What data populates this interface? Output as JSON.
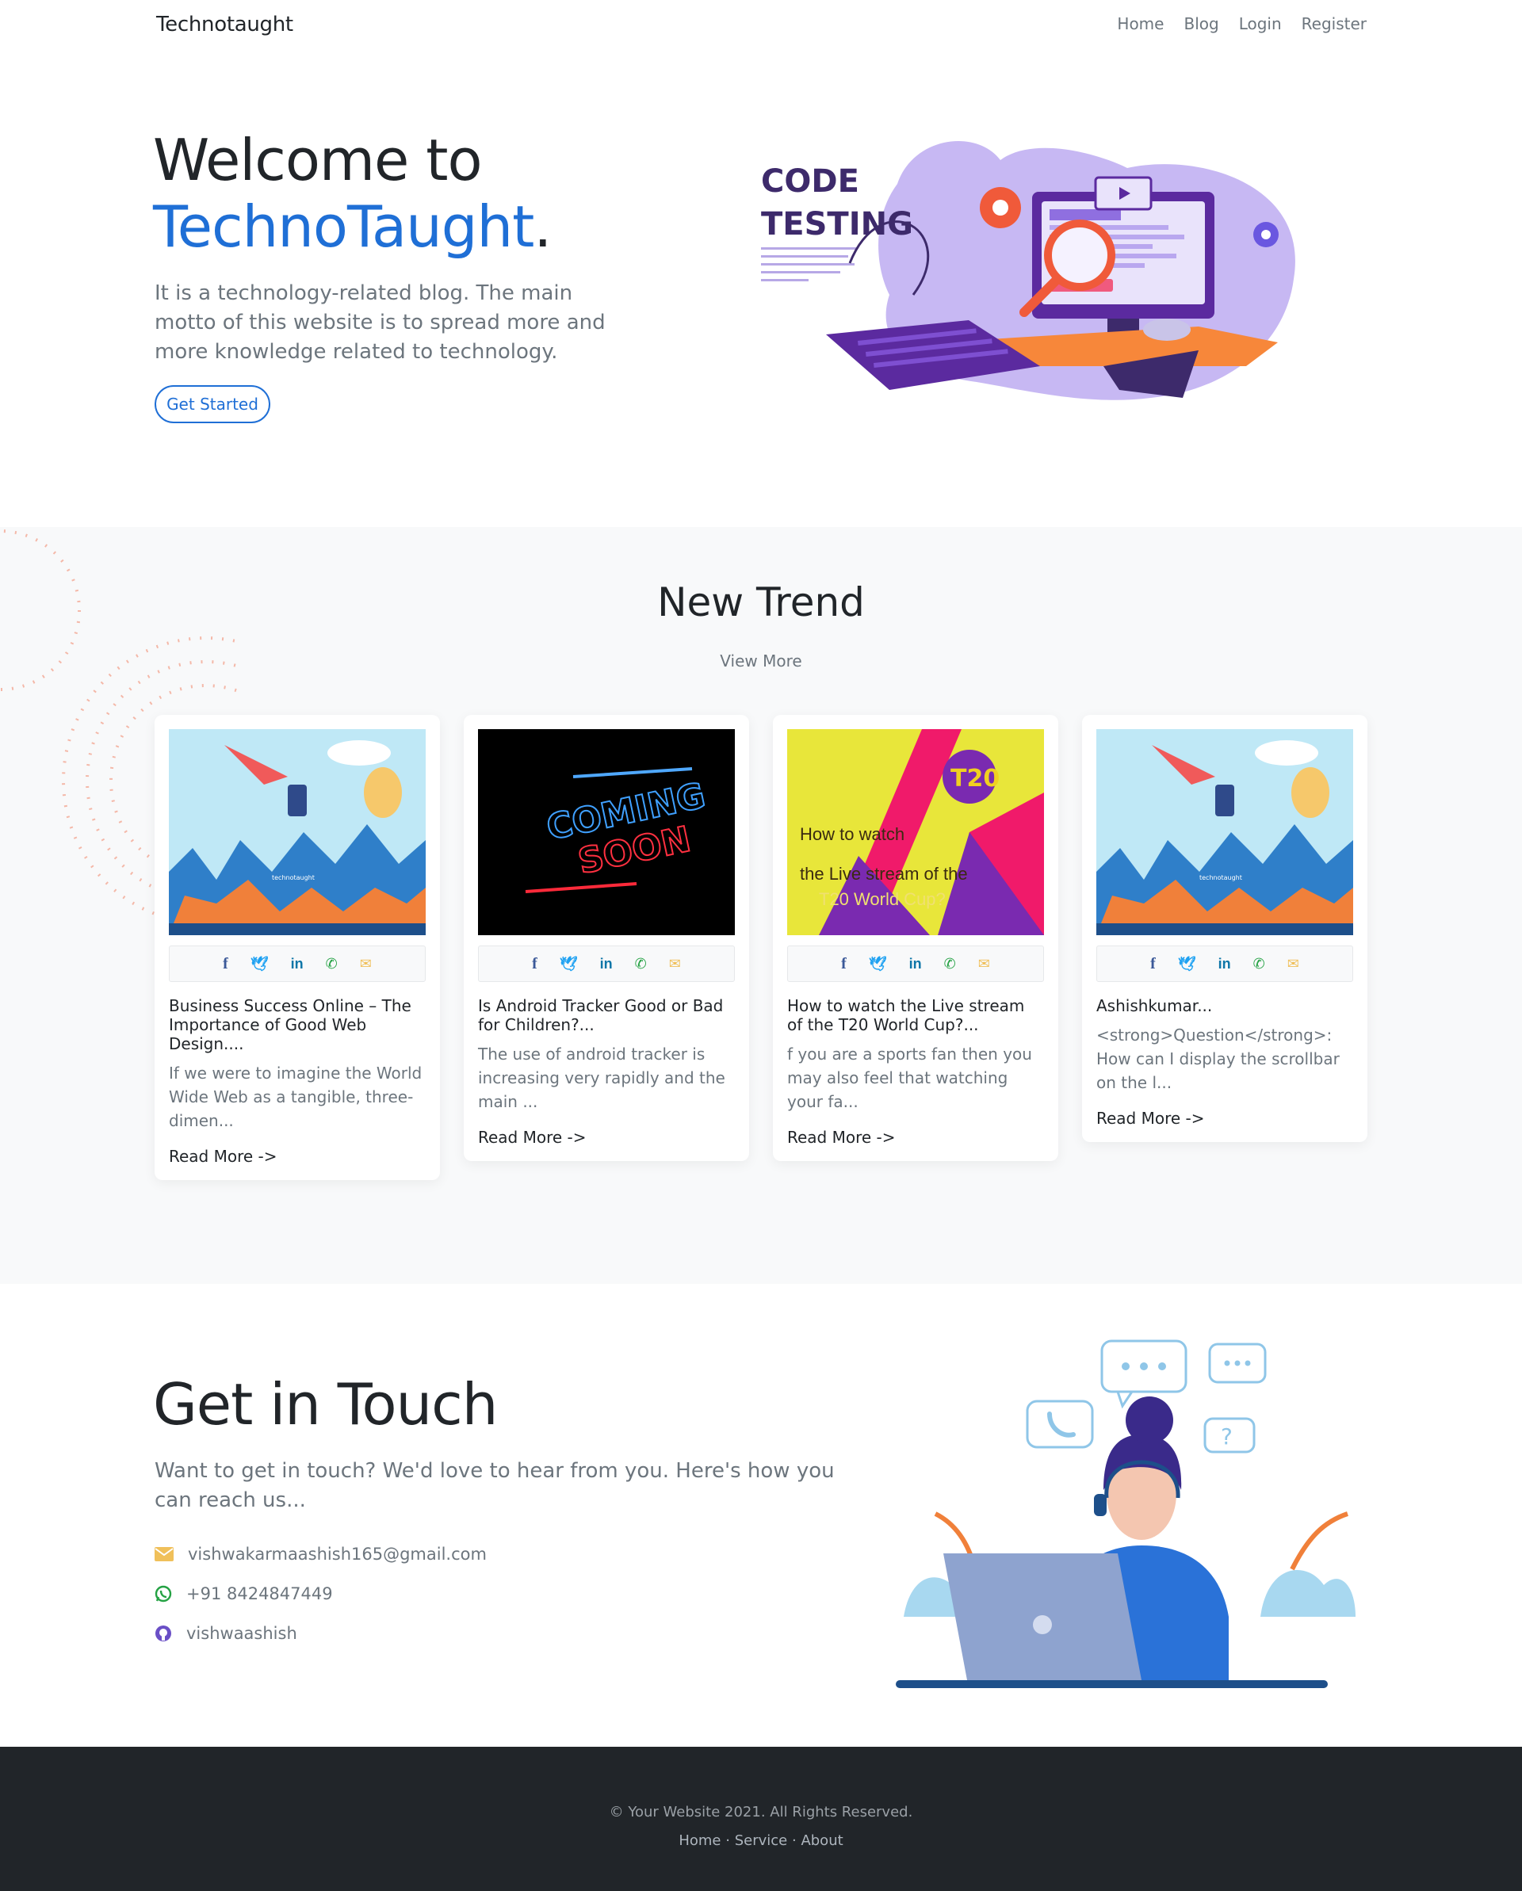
{
  "nav": {
    "brand": "Technotaught",
    "links": [
      "Home",
      "Blog",
      "Login",
      "Register"
    ]
  },
  "hero": {
    "title_line1": "Welcome to",
    "title_brand": "TechnoTaught",
    "title_dot": ".",
    "text": "It is a technology-related blog. The main motto of this website is to spread more and more knowledge related to technology.",
    "button": "Get Started",
    "art_caption_1": "CODE",
    "art_caption_2": "TESTING"
  },
  "trend": {
    "title": "New Trend",
    "view_more": "View More",
    "cards": [
      {
        "title": "Business Success Online – The Importance of Good Web Design....",
        "text": "If we were to imagine the World Wide Web as a tangible, three-dimen...",
        "read_more": "Read More ->",
        "image_label": "technotaught"
      },
      {
        "title": "Is Android Tracker Good or Bad for Children?...",
        "text": "The use of android tracker is increasing very rapidly and the main ...",
        "read_more": "Read More ->",
        "image_label_1": "COMING",
        "image_label_2": "SOON"
      },
      {
        "title": "How to watch the Live stream of the T20 World Cup?...",
        "text": "f you are a sports fan then you may also feel that watching your fa...",
        "read_more": "Read More ->",
        "image_label_1": "How to watch",
        "image_label_2": "the Live stream of the",
        "image_label_3": "T20 World Cup?",
        "image_badge": "T20"
      },
      {
        "title": "Ashishkumar...",
        "text": "<strong>Question</strong>: How can I display the scrollbar on the l...",
        "read_more": "Read More ->",
        "image_label": "technotaught"
      }
    ],
    "share_icons": [
      "facebook-icon",
      "twitter-icon",
      "linkedin-icon",
      "whatsapp-icon",
      "email-icon"
    ]
  },
  "contact": {
    "title": "Get in Touch",
    "text": "Want to get in touch? We'd love to hear from you. Here's how you can reach us...",
    "email": "vishwakarmaashish165@gmail.com",
    "phone": "+91 8424847449",
    "github": "vishwaashish"
  },
  "footer": {
    "copyright": "© Your Website 2021. All Rights Reserved.",
    "links": [
      "Home",
      "Service",
      "About"
    ],
    "separator": "·"
  },
  "colors": {
    "primary": "#1f6fd6",
    "text": "#212529",
    "muted": "#6c757d",
    "section_bg": "#f8f9fa",
    "footer_bg": "#212529"
  }
}
